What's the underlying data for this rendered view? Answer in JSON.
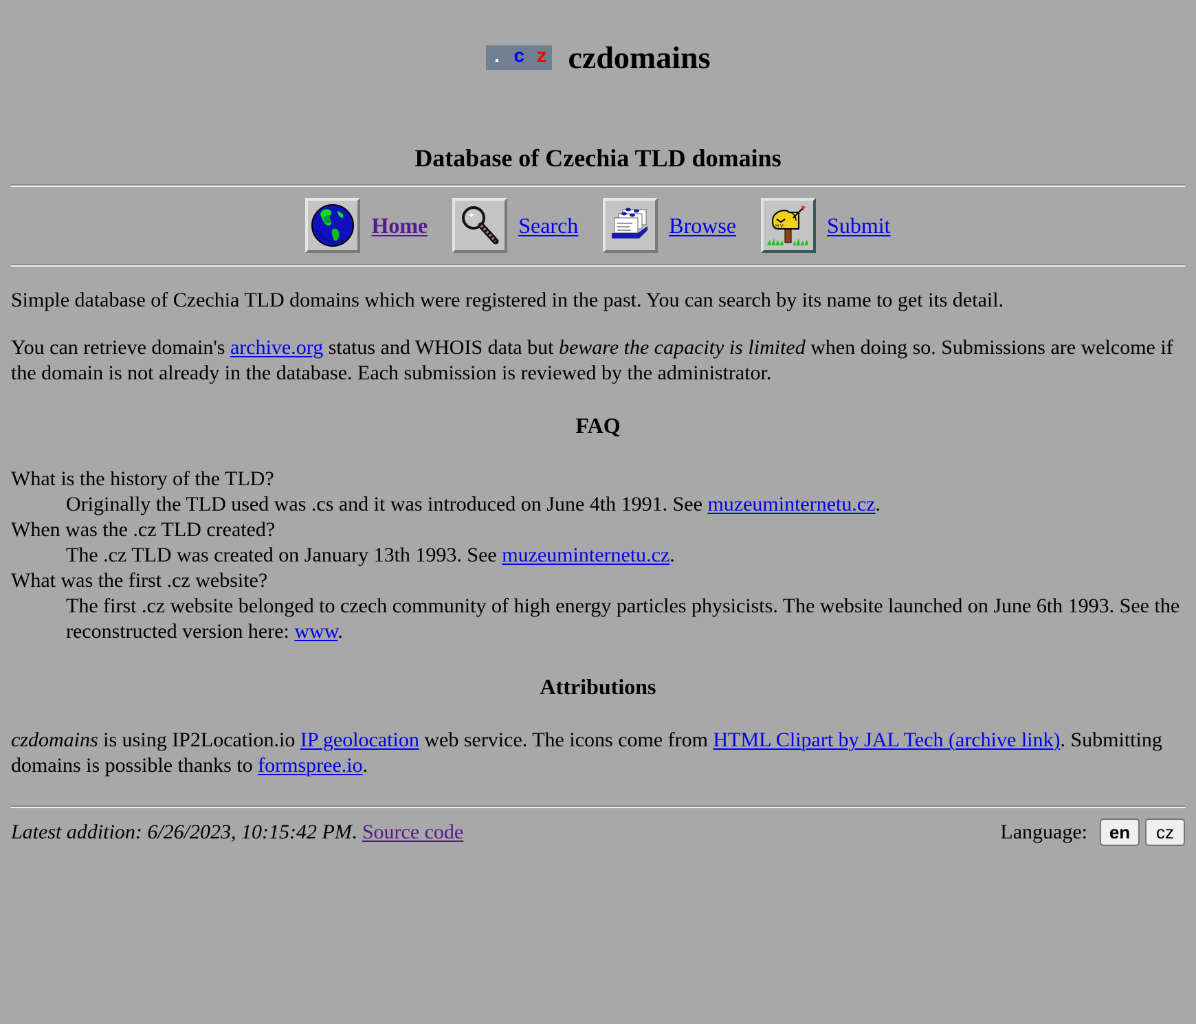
{
  "header": {
    "logo": {
      "dot": ".",
      "c": "c",
      "z": "z"
    },
    "site_name": "czdomains",
    "subtitle": "Database of Czechia TLD domains"
  },
  "nav": {
    "items": [
      {
        "label": "Home",
        "icon": "globe-icon",
        "active": true
      },
      {
        "label": "Search",
        "icon": "magnifier-icon"
      },
      {
        "label": "Browse",
        "icon": "card-file-icon"
      },
      {
        "label": "Submit",
        "icon": "mailbox-icon"
      }
    ]
  },
  "intro": {
    "paragraph1": "Simple database of Czechia TLD domains which were registered in the past. You can search by its name to get its detail.",
    "paragraph2": {
      "before_link": "You can retrieve domain's ",
      "link": "archive.org",
      "after_link": " status and WHOIS data but ",
      "emphasis": "beware the capacity is limited",
      "after_emphasis": " when doing so. Submissions are welcome if the domain is not already in the database. Each submission is reviewed by the administrator."
    }
  },
  "faq": {
    "heading": "FAQ",
    "items": [
      {
        "question": "What is the history of the TLD?",
        "answer_before": "Originally the TLD used was .cs and it was introduced on June 4th 1991. See ",
        "link": "muzeuminternetu.cz",
        "answer_after": "."
      },
      {
        "question": "When was the .cz TLD created?",
        "answer_before": "The .cz TLD was created on January 13th 1993. See ",
        "link": "muzeuminternetu.cz",
        "answer_after": "."
      },
      {
        "question": "What was the first .cz website?",
        "answer_before": "The first .cz website belonged to czech community of high energy particles physicists. The website launched on June 6th 1993. See the reconstructed version here: ",
        "link": "www",
        "answer_after": "."
      }
    ]
  },
  "attributions": {
    "heading": "Attributions",
    "name_italic": "czdomains",
    "text1": " is using IP2Location.io ",
    "link1": "IP geolocation",
    "text2": " web service. The icons come from ",
    "link2": "HTML Clipart by JAL Tech (archive link)",
    "text3": ". Submitting domains is possible thanks to ",
    "link3": "formspree.io",
    "text4": "."
  },
  "footer": {
    "latest_label": "Latest addition: 6/26/2023, 10:15:42 PM",
    "latest_suffix": ". ",
    "source_link": "Source code",
    "language_label": "Language:",
    "languages": [
      {
        "code": "en",
        "active": true
      },
      {
        "code": "cz",
        "active": false
      }
    ]
  },
  "colors": {
    "background": "#a8a8a8",
    "link": "#0000ee",
    "visited_link": "#551a8b",
    "logo_background": "#708090"
  }
}
